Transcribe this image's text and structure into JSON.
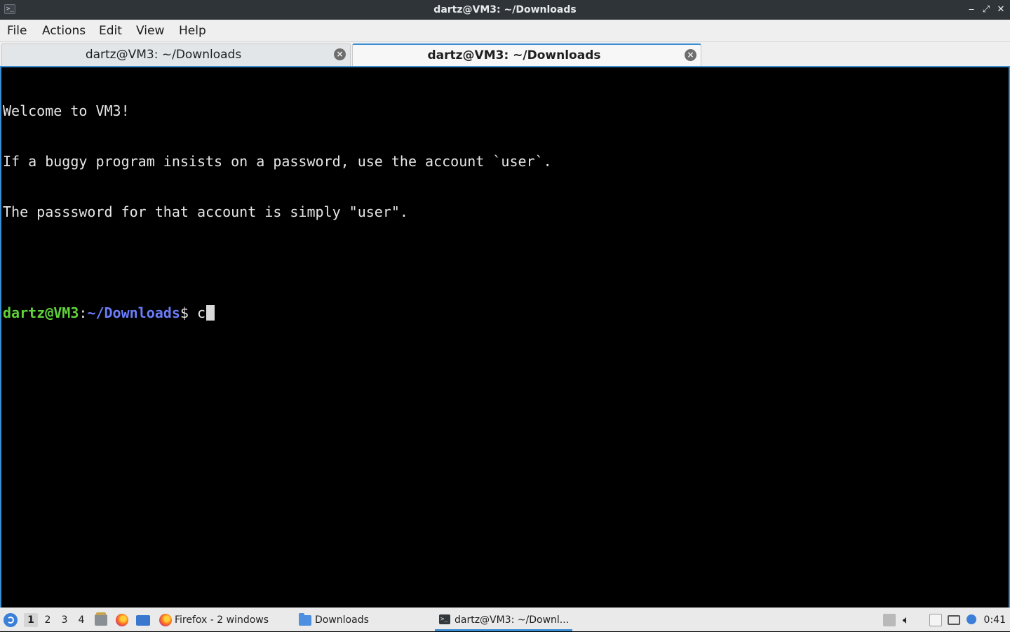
{
  "window": {
    "title": "dartz@VM3: ~/Downloads",
    "controls": {
      "minimize": "‒",
      "maximize": "⤢",
      "close": "✕"
    }
  },
  "menu": [
    "File",
    "Actions",
    "Edit",
    "View",
    "Help"
  ],
  "tabs": [
    {
      "label": "dartz@VM3: ~/Downloads",
      "active": false
    },
    {
      "label": "dartz@VM3: ~/Downloads",
      "active": true
    }
  ],
  "terminal": {
    "lines": [
      "Welcome to VM3!",
      "If a buggy program insists on a password, use the account `user`.",
      "The passsword for that account is simply \"user\"."
    ],
    "prompt": {
      "user_host": "dartz@VM3",
      "colon": ":",
      "path": "~/Downloads",
      "dollar": "$ "
    },
    "input": "c"
  },
  "taskbar": {
    "desktops": [
      "1",
      "2",
      "3",
      "4"
    ],
    "current_desktop": "1",
    "tasks": {
      "firefox": "Firefox - 2 windows",
      "downloads": "Downloads",
      "terminal": "dartz@VM3: ~/Downl..."
    },
    "clock": "0:41"
  },
  "colors": {
    "accent": "#3c8ed3",
    "prompt_user": "#5fd23a",
    "prompt_path": "#6b7dfa",
    "terminal_bg": "#000000",
    "terminal_fg": "#e6e6e6"
  },
  "icons": {
    "app": "terminal-icon",
    "start": "start-menu-icon",
    "quicklaunch": [
      "file-manager-icon",
      "firefox-icon",
      "show-desktop-icon"
    ],
    "tray": [
      "panel-tray-icon",
      "volume-icon",
      "clipboard-icon",
      "network-icon",
      "notification-icon"
    ]
  }
}
